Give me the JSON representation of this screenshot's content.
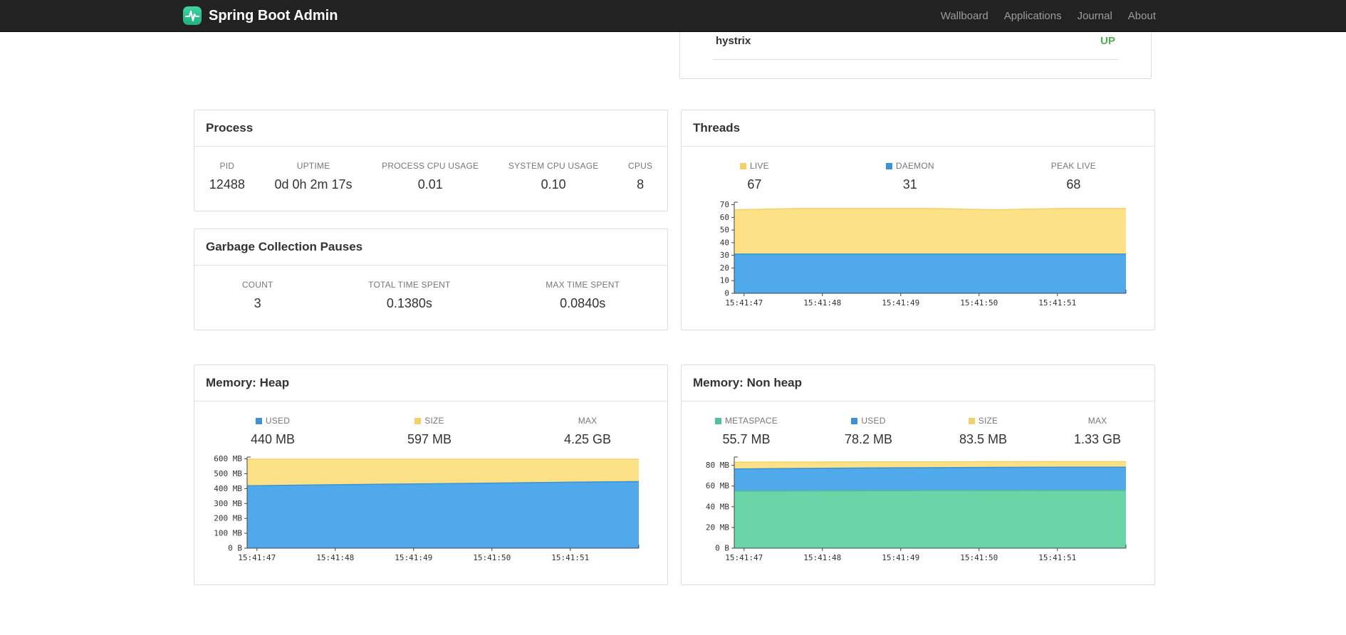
{
  "navbar": {
    "brand": "Spring Boot Admin",
    "items": [
      {
        "label": "Wallboard"
      },
      {
        "label": "Applications"
      },
      {
        "label": "Journal"
      },
      {
        "label": "About"
      }
    ]
  },
  "applications": {
    "rows": [
      {
        "name": "hystrix",
        "status": "UP"
      }
    ],
    "status_up_color": "#4caf50"
  },
  "panels": {
    "process": {
      "title": "Process",
      "metrics": [
        {
          "label": "PID",
          "value": "12488"
        },
        {
          "label": "UPTIME",
          "value": "0d 0h 2m 17s"
        },
        {
          "label": "PROCESS CPU USAGE",
          "value": "0.01"
        },
        {
          "label": "SYSTEM CPU USAGE",
          "value": "0.10"
        },
        {
          "label": "CPUS",
          "value": "8"
        }
      ]
    },
    "gc": {
      "title": "Garbage Collection Pauses",
      "metrics": [
        {
          "label": "COUNT",
          "value": "3"
        },
        {
          "label": "TOTAL TIME SPENT",
          "value": "0.1380s"
        },
        {
          "label": "MAX TIME SPENT",
          "value": "0.0840s"
        }
      ]
    },
    "threads": {
      "title": "Threads",
      "metrics": [
        {
          "label": "LIVE",
          "value": "67",
          "swatch": "#f3d168"
        },
        {
          "label": "DAEMON",
          "value": "31",
          "swatch": "#3b93d6"
        },
        {
          "label": "PEAK LIVE",
          "value": "68"
        }
      ]
    },
    "heap": {
      "title": "Memory: Heap",
      "metrics": [
        {
          "label": "USED",
          "value": "440 MB",
          "swatch": "#3b93d6"
        },
        {
          "label": "SIZE",
          "value": "597 MB",
          "swatch": "#f3d168"
        },
        {
          "label": "MAX",
          "value": "4.25 GB"
        }
      ]
    },
    "nonheap": {
      "title": "Memory: Non heap",
      "metrics": [
        {
          "label": "METASPACE",
          "value": "55.7 MB",
          "swatch": "#52c291"
        },
        {
          "label": "USED",
          "value": "78.2 MB",
          "swatch": "#3b93d6"
        },
        {
          "label": "SIZE",
          "value": "83.5 MB",
          "swatch": "#f3d168"
        },
        {
          "label": "MAX",
          "value": "1.33 GB"
        }
      ]
    }
  },
  "chart_data": [
    {
      "id": "threads",
      "type": "area",
      "title": "Threads",
      "x_ticks": [
        "15:41:47",
        "15:41:48",
        "15:41:49",
        "15:41:50",
        "15:41:51"
      ],
      "ylim": [
        0,
        72
      ],
      "y_ticks": [
        {
          "v": 70,
          "label": "70"
        },
        {
          "v": 60,
          "label": "60"
        },
        {
          "v": 50,
          "label": "50"
        },
        {
          "v": 40,
          "label": "40"
        },
        {
          "v": 30,
          "label": "30"
        },
        {
          "v": 20,
          "label": "20"
        },
        {
          "v": 10,
          "label": "10"
        },
        {
          "v": 0,
          "label": "0"
        }
      ],
      "series": [
        {
          "name": "LIVE",
          "fill": "#fde187",
          "line": "#f3d168",
          "values": [
            66,
            67,
            67,
            67,
            66,
            67,
            67
          ]
        },
        {
          "name": "DAEMON",
          "fill": "#4fa9ea",
          "line": "#3b93d6",
          "values": [
            31,
            31,
            31,
            31,
            31,
            31,
            31
          ]
        }
      ]
    },
    {
      "id": "heap",
      "type": "area",
      "title": "Memory: Heap",
      "x_ticks": [
        "15:41:47",
        "15:41:48",
        "15:41:49",
        "15:41:50",
        "15:41:51"
      ],
      "ylim": [
        0,
        612
      ],
      "y_ticks": [
        {
          "v": 600,
          "label": "600 MB"
        },
        {
          "v": 500,
          "label": "500 MB"
        },
        {
          "v": 400,
          "label": "400 MB"
        },
        {
          "v": 300,
          "label": "300 MB"
        },
        {
          "v": 200,
          "label": "200 MB"
        },
        {
          "v": 100,
          "label": "100 MB"
        },
        {
          "v": 0,
          "label": "0 B"
        }
      ],
      "series": [
        {
          "name": "SIZE",
          "fill": "#fde187",
          "line": "#f3d168",
          "values": [
            597,
            597,
            597,
            597,
            597,
            597,
            597
          ]
        },
        {
          "name": "USED",
          "fill": "#4fa9ea",
          "line": "#3b93d6",
          "values": [
            419,
            424,
            429,
            433,
            438,
            443,
            447
          ]
        }
      ]
    },
    {
      "id": "nonheap",
      "type": "area",
      "title": "Memory: Non heap",
      "x_ticks": [
        "15:41:47",
        "15:41:48",
        "15:41:49",
        "15:41:50",
        "15:41:51"
      ],
      "ylim": [
        0,
        88
      ],
      "y_ticks": [
        {
          "v": 80,
          "label": "80 MB"
        },
        {
          "v": 60,
          "label": "60 MB"
        },
        {
          "v": 40,
          "label": "40 MB"
        },
        {
          "v": 20,
          "label": "20 MB"
        },
        {
          "v": 0,
          "label": "0 B"
        }
      ],
      "series": [
        {
          "name": "SIZE",
          "fill": "#fde187",
          "line": "#f3d168",
          "values": [
            83.0,
            83.2,
            83.3,
            83.4,
            83.5,
            83.5,
            83.5
          ]
        },
        {
          "name": "USED",
          "fill": "#4fa9ea",
          "line": "#3b93d6",
          "values": [
            76.5,
            77.0,
            77.4,
            77.7,
            78.0,
            78.2,
            78.2
          ]
        },
        {
          "name": "METASPACE",
          "fill": "#6ad6a8",
          "line": "#52c291",
          "values": [
            55.0,
            55.2,
            55.4,
            55.5,
            55.6,
            55.7,
            55.7
          ]
        }
      ]
    }
  ]
}
